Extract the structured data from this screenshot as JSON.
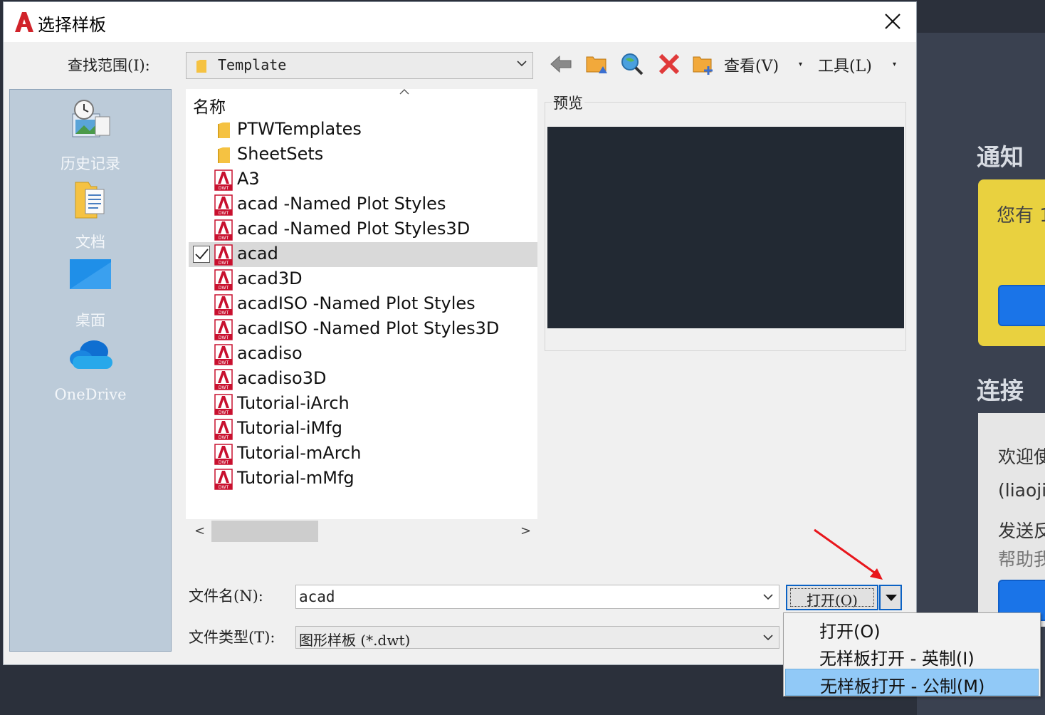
{
  "dialog": {
    "title": "选择样板",
    "look_in_label": "查找范围(I):",
    "look_in_value": "Template",
    "toolbar": {
      "view_label": "查看(V)",
      "tools_label": "工具(L)",
      "icons": [
        "back-arrow-icon",
        "up-folder-icon",
        "search-web-icon",
        "delete-icon",
        "new-folder-icon"
      ]
    },
    "places": [
      {
        "label": "历史记录",
        "icon": "history-icon"
      },
      {
        "label": "文档",
        "icon": "documents-folder-icon"
      },
      {
        "label": "桌面",
        "icon": "desktop-icon"
      },
      {
        "label": "OneDrive",
        "icon": "onedrive-cloud-icon"
      }
    ],
    "file_list": {
      "column_header": "名称",
      "items": [
        {
          "name": "PTWTemplates",
          "type": "folder"
        },
        {
          "name": "SheetSets",
          "type": "folder"
        },
        {
          "name": "A3",
          "type": "dwt"
        },
        {
          "name": "acad -Named Plot Styles",
          "type": "dwt"
        },
        {
          "name": "acad -Named Plot Styles3D",
          "type": "dwt"
        },
        {
          "name": "acad",
          "type": "dwt",
          "selected": true
        },
        {
          "name": "acad3D",
          "type": "dwt"
        },
        {
          "name": "acadISO -Named Plot Styles",
          "type": "dwt"
        },
        {
          "name": "acadISO -Named Plot Styles3D",
          "type": "dwt"
        },
        {
          "name": "acadiso",
          "type": "dwt"
        },
        {
          "name": "acadiso3D",
          "type": "dwt"
        },
        {
          "name": "Tutorial-iArch",
          "type": "dwt"
        },
        {
          "name": "Tutorial-iMfg",
          "type": "dwt"
        },
        {
          "name": "Tutorial-mArch",
          "type": "dwt"
        },
        {
          "name": "Tutorial-mMfg",
          "type": "dwt"
        }
      ],
      "dwt_badge": "DWT"
    },
    "preview_label": "预览",
    "file_name_label": "文件名(N):",
    "file_name_value": "acad",
    "file_type_label": "文件类型(T):",
    "file_type_value": "图形样板 (*.dwt)",
    "open_button_label": "打开(O)",
    "open_menu": [
      {
        "label": "打开(O)",
        "highlighted": false
      },
      {
        "label": "无样板打开 - 英制(I)",
        "highlighted": false
      },
      {
        "label": "无样板打开 - 公制(M)",
        "highlighted": true
      }
    ]
  },
  "background_app": {
    "section_notify": "通知",
    "notify_text": "您有 1",
    "section_connect": "连接",
    "connect_lines": [
      "欢迎使",
      "(liaoji",
      "发送反",
      "帮助我"
    ]
  },
  "colors": {
    "accent": "#0b62c4",
    "menu_highlight": "#91c9f7",
    "preview_bg": "#222933",
    "places_bg": "#bccbd9",
    "dwt_red": "#c8102e"
  }
}
